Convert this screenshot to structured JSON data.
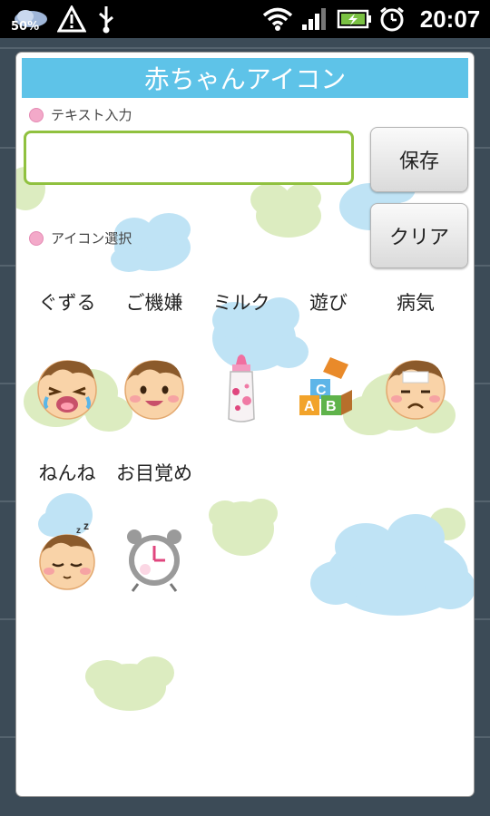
{
  "status_bar": {
    "battery_percent": "50%",
    "time": "20:07",
    "icons": [
      "weather-icon",
      "warning-icon",
      "usb-icon",
      "wifi-icon",
      "signal-icon",
      "battery-charging-icon",
      "alarm-icon"
    ]
  },
  "dialog": {
    "title": "赤ちゃんアイコン",
    "text_section_label": "テキスト入力",
    "text_input_value": "",
    "save_button": "保存",
    "clear_button": "クリア",
    "icon_section_label": "アイコン選択",
    "icons": [
      {
        "label": "ぐずる",
        "icon": "crying-baby-icon"
      },
      {
        "label": "ご機嫌",
        "icon": "happy-baby-icon"
      },
      {
        "label": "ミルク",
        "icon": "milk-bottle-icon"
      },
      {
        "label": "遊び",
        "icon": "abc-blocks-icon"
      },
      {
        "label": "病気",
        "icon": "sick-baby-icon"
      },
      {
        "label": "ねんね",
        "icon": "sleeping-baby-icon"
      },
      {
        "label": "お目覚め",
        "icon": "alarm-clock-icon"
      }
    ]
  },
  "colors": {
    "title_bar": "#5ec3e8",
    "input_border": "#90c13f",
    "label_dot": "#f3a9c9",
    "cloud_blue": "#bfe3f5",
    "cloud_green": "#dcecc0"
  }
}
